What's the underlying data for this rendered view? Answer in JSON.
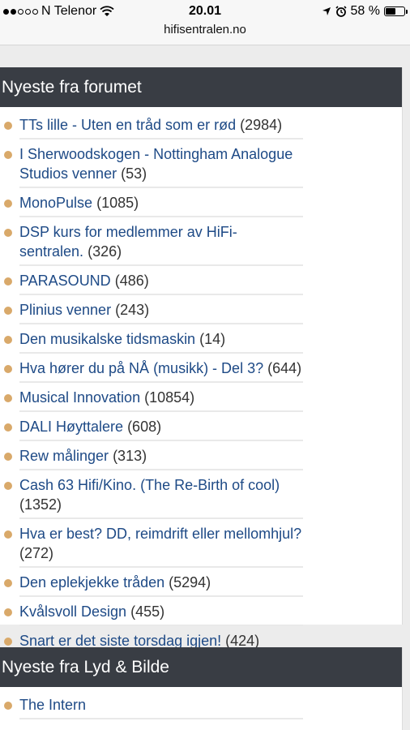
{
  "status_bar": {
    "carrier": "N Telenor",
    "time": "20.01",
    "battery": "58 %",
    "battery_level": 0.58
  },
  "address": {
    "domain": "hifisentralen.no"
  },
  "forum_section": {
    "title": "Nyeste fra forumet",
    "topics": [
      {
        "title": "TTs lille - Uten en tråd som er rød",
        "count": "(2984)"
      },
      {
        "title": "I Sherwoodskogen - Nottingham Analogue Studios venner",
        "count": "(53)"
      },
      {
        "title": "MonoPulse",
        "count": "(1085)"
      },
      {
        "title": "DSP kurs for medlemmer av HiFi- sentralen.",
        "count": "(326)"
      },
      {
        "title": "PARASOUND",
        "count": "(486)"
      },
      {
        "title": "Plinius venner",
        "count": "(243)"
      },
      {
        "title": "Den musikalske tidsmaskin",
        "count": "(14)"
      },
      {
        "title": "Hva hører du på NÅ (musikk) - Del 3?",
        "count": "(644)"
      },
      {
        "title": "Musical Innovation",
        "count": "(10854)"
      },
      {
        "title": "DALI Høyttalere",
        "count": "(608)"
      },
      {
        "title": "Rew målinger",
        "count": "(313)"
      },
      {
        "title": "Cash 63 Hifi/Kino. (The Re-Birth of cool)",
        "count": "(1352)"
      },
      {
        "title": "Hva er best? DD, reimdrift eller mellomhjul?",
        "count": "(272)"
      },
      {
        "title": "Den eplekjekke tråden",
        "count": "(5294)"
      },
      {
        "title": "Kvålsvoll Design",
        "count": "(455)"
      },
      {
        "title": "Snart er det siste torsdag igjen!",
        "count": "(424)"
      }
    ]
  },
  "lyd_section": {
    "title": "Nyeste fra Lyd & Bilde",
    "items": [
      {
        "title": "The Intern"
      }
    ]
  },
  "colors": {
    "header_bg": "#393d44",
    "link": "#1e4a86",
    "bullet": "#d9a96a"
  }
}
